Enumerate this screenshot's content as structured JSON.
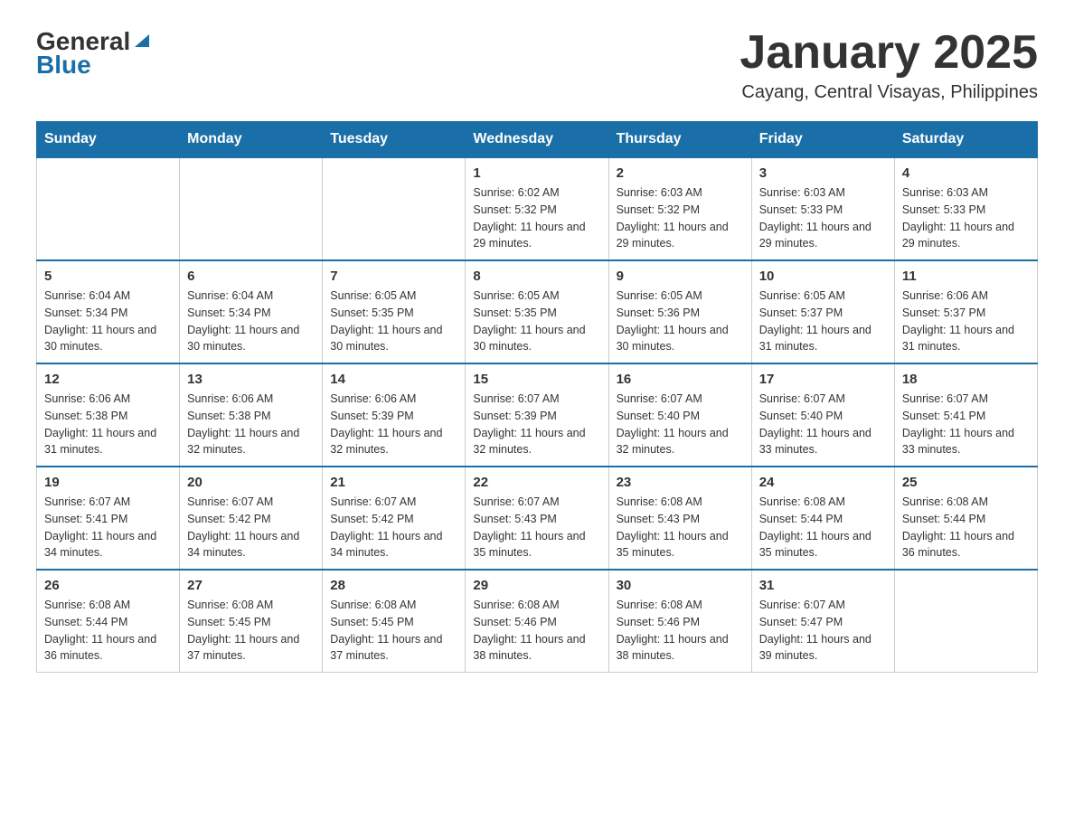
{
  "logo": {
    "text_general": "General",
    "text_blue": "Blue"
  },
  "title": "January 2025",
  "subtitle": "Cayang, Central Visayas, Philippines",
  "days_of_week": [
    "Sunday",
    "Monday",
    "Tuesday",
    "Wednesday",
    "Thursday",
    "Friday",
    "Saturday"
  ],
  "weeks": [
    [
      {
        "day": null,
        "info": null
      },
      {
        "day": null,
        "info": null
      },
      {
        "day": null,
        "info": null
      },
      {
        "day": "1",
        "info": "Sunrise: 6:02 AM\nSunset: 5:32 PM\nDaylight: 11 hours and 29 minutes."
      },
      {
        "day": "2",
        "info": "Sunrise: 6:03 AM\nSunset: 5:32 PM\nDaylight: 11 hours and 29 minutes."
      },
      {
        "day": "3",
        "info": "Sunrise: 6:03 AM\nSunset: 5:33 PM\nDaylight: 11 hours and 29 minutes."
      },
      {
        "day": "4",
        "info": "Sunrise: 6:03 AM\nSunset: 5:33 PM\nDaylight: 11 hours and 29 minutes."
      }
    ],
    [
      {
        "day": "5",
        "info": "Sunrise: 6:04 AM\nSunset: 5:34 PM\nDaylight: 11 hours and 30 minutes."
      },
      {
        "day": "6",
        "info": "Sunrise: 6:04 AM\nSunset: 5:34 PM\nDaylight: 11 hours and 30 minutes."
      },
      {
        "day": "7",
        "info": "Sunrise: 6:05 AM\nSunset: 5:35 PM\nDaylight: 11 hours and 30 minutes."
      },
      {
        "day": "8",
        "info": "Sunrise: 6:05 AM\nSunset: 5:35 PM\nDaylight: 11 hours and 30 minutes."
      },
      {
        "day": "9",
        "info": "Sunrise: 6:05 AM\nSunset: 5:36 PM\nDaylight: 11 hours and 30 minutes."
      },
      {
        "day": "10",
        "info": "Sunrise: 6:05 AM\nSunset: 5:37 PM\nDaylight: 11 hours and 31 minutes."
      },
      {
        "day": "11",
        "info": "Sunrise: 6:06 AM\nSunset: 5:37 PM\nDaylight: 11 hours and 31 minutes."
      }
    ],
    [
      {
        "day": "12",
        "info": "Sunrise: 6:06 AM\nSunset: 5:38 PM\nDaylight: 11 hours and 31 minutes."
      },
      {
        "day": "13",
        "info": "Sunrise: 6:06 AM\nSunset: 5:38 PM\nDaylight: 11 hours and 32 minutes."
      },
      {
        "day": "14",
        "info": "Sunrise: 6:06 AM\nSunset: 5:39 PM\nDaylight: 11 hours and 32 minutes."
      },
      {
        "day": "15",
        "info": "Sunrise: 6:07 AM\nSunset: 5:39 PM\nDaylight: 11 hours and 32 minutes."
      },
      {
        "day": "16",
        "info": "Sunrise: 6:07 AM\nSunset: 5:40 PM\nDaylight: 11 hours and 32 minutes."
      },
      {
        "day": "17",
        "info": "Sunrise: 6:07 AM\nSunset: 5:40 PM\nDaylight: 11 hours and 33 minutes."
      },
      {
        "day": "18",
        "info": "Sunrise: 6:07 AM\nSunset: 5:41 PM\nDaylight: 11 hours and 33 minutes."
      }
    ],
    [
      {
        "day": "19",
        "info": "Sunrise: 6:07 AM\nSunset: 5:41 PM\nDaylight: 11 hours and 34 minutes."
      },
      {
        "day": "20",
        "info": "Sunrise: 6:07 AM\nSunset: 5:42 PM\nDaylight: 11 hours and 34 minutes."
      },
      {
        "day": "21",
        "info": "Sunrise: 6:07 AM\nSunset: 5:42 PM\nDaylight: 11 hours and 34 minutes."
      },
      {
        "day": "22",
        "info": "Sunrise: 6:07 AM\nSunset: 5:43 PM\nDaylight: 11 hours and 35 minutes."
      },
      {
        "day": "23",
        "info": "Sunrise: 6:08 AM\nSunset: 5:43 PM\nDaylight: 11 hours and 35 minutes."
      },
      {
        "day": "24",
        "info": "Sunrise: 6:08 AM\nSunset: 5:44 PM\nDaylight: 11 hours and 35 minutes."
      },
      {
        "day": "25",
        "info": "Sunrise: 6:08 AM\nSunset: 5:44 PM\nDaylight: 11 hours and 36 minutes."
      }
    ],
    [
      {
        "day": "26",
        "info": "Sunrise: 6:08 AM\nSunset: 5:44 PM\nDaylight: 11 hours and 36 minutes."
      },
      {
        "day": "27",
        "info": "Sunrise: 6:08 AM\nSunset: 5:45 PM\nDaylight: 11 hours and 37 minutes."
      },
      {
        "day": "28",
        "info": "Sunrise: 6:08 AM\nSunset: 5:45 PM\nDaylight: 11 hours and 37 minutes."
      },
      {
        "day": "29",
        "info": "Sunrise: 6:08 AM\nSunset: 5:46 PM\nDaylight: 11 hours and 38 minutes."
      },
      {
        "day": "30",
        "info": "Sunrise: 6:08 AM\nSunset: 5:46 PM\nDaylight: 11 hours and 38 minutes."
      },
      {
        "day": "31",
        "info": "Sunrise: 6:07 AM\nSunset: 5:47 PM\nDaylight: 11 hours and 39 minutes."
      },
      {
        "day": null,
        "info": null
      }
    ]
  ]
}
